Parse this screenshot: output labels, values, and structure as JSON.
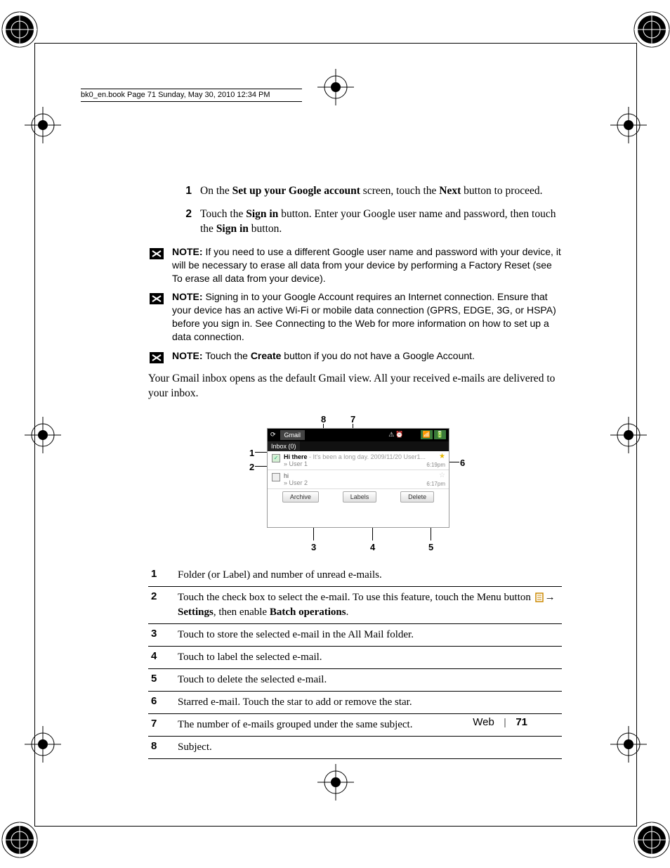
{
  "header": "bk0_en.book  Page 71  Sunday, May 30, 2010  12:34 PM",
  "steps": [
    {
      "num": "1",
      "parts": [
        "On the ",
        "Set up your Google account",
        " screen, touch the ",
        "Next",
        " button to proceed."
      ]
    },
    {
      "num": "2",
      "parts": [
        "Touch the ",
        "Sign in",
        " button. Enter your Google user name and password, then touch the ",
        "Sign in",
        " button."
      ]
    }
  ],
  "notes": [
    {
      "label": "NOTE:",
      "text": " If you need to use a different Google user name and password with your device, it will be necessary to erase all data from your device by performing a Factory Reset (see To erase all data from your device)."
    },
    {
      "label": "NOTE:",
      "text": " Signing in to your Google Account requires an Internet connection. Ensure that your device has an active Wi-Fi or mobile data connection (GPRS, EDGE, 3G, or HSPA) before you sign in. See Connecting to the Web for more information on how to set up a data connection."
    },
    {
      "label": "NOTE:",
      "text_pre": " Touch the ",
      "bold": "Create",
      "text_post": " button if you do not have a Google Account."
    }
  ],
  "paragraph": "Your Gmail inbox opens as the default Gmail view. All your received e-mails are delivered to your inbox.",
  "figure": {
    "callouts": {
      "1": "1",
      "2": "2",
      "3": "3",
      "4": "4",
      "5": "5",
      "6": "6",
      "7": "7",
      "8": "8"
    },
    "statusbar": {
      "gmail": "Gmail"
    },
    "inbox_label": "Inbox (0)",
    "emails": [
      {
        "subject": "Hi there",
        "preview": " - It's been a long day. 2009/11/20 User1...",
        "sender": "» User 1",
        "time": "6:19pm",
        "starred": true,
        "checked": true
      },
      {
        "subject": "hi",
        "preview": "",
        "sender": "» User 2",
        "time": "6:17pm",
        "starred": false,
        "checked": false
      }
    ],
    "buttons": {
      "archive": "Archive",
      "labels": "Labels",
      "delete": "Delete"
    }
  },
  "legend": [
    {
      "num": "1",
      "desc": "Folder (or Label) and number of unread e-mails."
    },
    {
      "num": "2",
      "desc_parts": [
        "Touch the check box to select the e-mail. To use this feature, touch the Menu button ",
        "ICON",
        "→ ",
        "Settings",
        ", then enable ",
        "Batch operations",
        "."
      ]
    },
    {
      "num": "3",
      "desc": "Touch to store the selected e-mail in the All Mail folder."
    },
    {
      "num": "4",
      "desc": "Touch to label the selected e-mail."
    },
    {
      "num": "5",
      "desc": "Touch to delete the selected e-mail."
    },
    {
      "num": "6",
      "desc": "Starred e-mail. Touch the star to add or remove the star."
    },
    {
      "num": "7",
      "desc": "The number of e-mails grouped under the same subject."
    },
    {
      "num": "8",
      "desc": "Subject."
    }
  ],
  "footer": {
    "section": "Web",
    "page": "71"
  }
}
